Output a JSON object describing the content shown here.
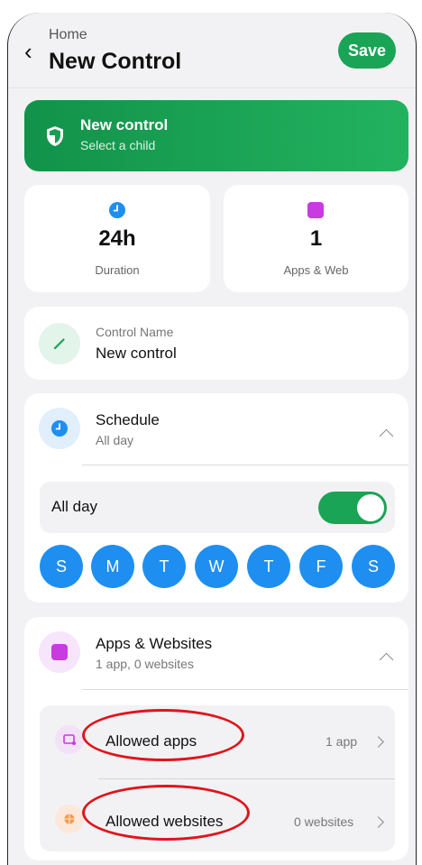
{
  "header": {
    "breadcrumb": "Home",
    "title": "New Control",
    "save_label": "Save"
  },
  "banner": {
    "title": "New control",
    "subtitle": "Select a child"
  },
  "stats": [
    {
      "value": "24h",
      "label": "Duration",
      "icon": "clock-icon",
      "color": "#1e8ff0"
    },
    {
      "value": "1",
      "label": "Apps & Web",
      "icon": "apps-square-icon",
      "color": "#c73be0"
    }
  ],
  "control_name": {
    "label": "Control Name",
    "value": "New control"
  },
  "schedule": {
    "title": "Schedule",
    "subtitle": "All day",
    "all_day_label": "All day",
    "all_day_on": true,
    "days": [
      "S",
      "M",
      "T",
      "W",
      "T",
      "F",
      "S"
    ]
  },
  "apps_websites": {
    "title": "Apps & Websites",
    "subtitle": "1 app, 0 websites",
    "items": [
      {
        "name": "Allowed apps",
        "meta": "1 app"
      },
      {
        "name": "Allowed websites",
        "meta": "0 websites"
      }
    ]
  },
  "colors": {
    "accent_green": "#1aa455",
    "accent_blue": "#1e8ff0",
    "accent_purple": "#c73be0",
    "annotation_red": "#e0141b"
  }
}
